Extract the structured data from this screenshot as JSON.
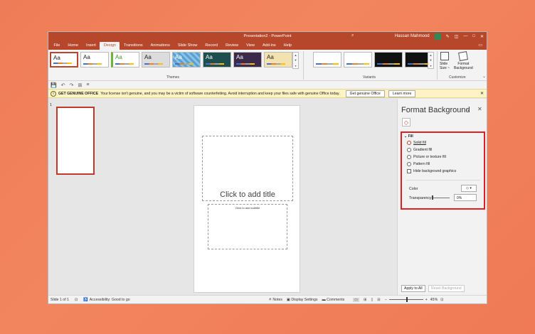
{
  "window": {
    "title": "Presentation2  -  PowerPoint",
    "user": "Hassan Mahmood",
    "controls": {
      "pen": "✎",
      "ribbon_opts": "◫",
      "minimize": "—",
      "maximize": "□",
      "close": "✕"
    }
  },
  "tabs": [
    "File",
    "Home",
    "Insert",
    "Design",
    "Transitions",
    "Animations",
    "Slide Show",
    "Record",
    "Review",
    "View",
    "Add-ins",
    "Help"
  ],
  "active_tab": "Design",
  "ribbon": {
    "themes": [
      {
        "label": "Aa",
        "bg": "#ffffff",
        "fg": "#222222"
      },
      {
        "label": "Aa",
        "bg": "#ffffff",
        "fg": "#222222"
      },
      {
        "label": "Aa",
        "bg": "#ffffff",
        "fg": "#4a8f2a"
      },
      {
        "label": "Aa",
        "bg": "#dcdcdc",
        "fg": "#222222"
      },
      {
        "label": "Aa",
        "bg": "#5aa0d0",
        "fg": "#ffffff"
      },
      {
        "label": "Aa",
        "bg": "#1f4e4e",
        "fg": "#ffffff"
      },
      {
        "label": "Aa",
        "bg": "#3c2a4a",
        "fg": "#ffffff"
      },
      {
        "label": "Aa",
        "bg": "#f2e2b0",
        "fg": "#333333"
      }
    ],
    "themes_label": "Themes",
    "variants_label": "Variants",
    "variants": [
      "light",
      "light",
      "dark",
      "dark"
    ],
    "customize": {
      "slide_size": "Slide\nSize ~",
      "format_background": "Format\nBackground",
      "label": "Customize"
    }
  },
  "qat": [
    "💾",
    "↶",
    "↷",
    "⊞",
    "≡"
  ],
  "infobar": {
    "title": "GET GENUINE OFFICE",
    "message": "Your license isn't genuine, and you may be a victim of software counterfeiting. Avoid interruption and keep your files safe with genuine Office today.",
    "btn_genuine": "Get genuine Office",
    "btn_learn": "Learn more"
  },
  "slides": {
    "thumb_number": "1",
    "title_placeholder": "Click to add title",
    "subtitle_placeholder": "Click to add subtitle"
  },
  "pane": {
    "title": "Format Background",
    "fill_header": "Fill",
    "options": [
      {
        "label": "Solid fill",
        "selected": true
      },
      {
        "label": "Gradient fill",
        "selected": false
      },
      {
        "label": "Picture or texture fill",
        "selected": false
      },
      {
        "label": "Pattern fill",
        "selected": false
      }
    ],
    "hide_graphics": "Hide background graphics",
    "color_label": "Color",
    "transparency_label": "Transparency",
    "transparency_value": "0%",
    "apply_all": "Apply to All",
    "reset": "Reset Background"
  },
  "status": {
    "slide_of": "Slide 1 of 1",
    "accessibility": "Accessibility: Good to go",
    "notes": "Notes",
    "display": "Display Settings",
    "comments": "Comments",
    "zoom": "45%"
  }
}
